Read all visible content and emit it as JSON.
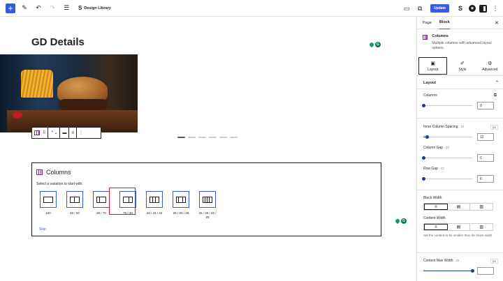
{
  "toolbar": {
    "design_library": "Design Library",
    "update_label": "Update"
  },
  "canvas": {
    "page_title": "GD Details"
  },
  "placeholder": {
    "title": "Columns",
    "instructions": "Select a variation to start with.",
    "variations": [
      {
        "label": "100"
      },
      {
        "label": "50 / 50"
      },
      {
        "label": "30 / 70"
      },
      {
        "label": "70 / 30"
      },
      {
        "label": "33 / 33 / 33"
      },
      {
        "label": "25 / 50 / 25"
      },
      {
        "label": "25 / 25 / 25 / 25"
      }
    ],
    "selected_variation": "70 / 30",
    "skip_label": "Skip"
  },
  "sidebar": {
    "tabs": {
      "page": "Page",
      "block": "Block"
    },
    "block_name": "Columns",
    "block_description": "Multiple columns with advanced layout options.",
    "subtabs": {
      "layout": "Layout",
      "style": "Style",
      "advanced": "Advanced"
    },
    "section_title": "Layout",
    "columns": {
      "label": "Columns",
      "value": "0"
    },
    "inner_column_spacing": {
      "label": "Inner Column Spacing",
      "unit": "px",
      "value": "12"
    },
    "column_gap": {
      "label": "Column Gap",
      "value": "0"
    },
    "row_gap": {
      "label": "Row Gap",
      "value": "0"
    },
    "block_width": {
      "label": "Block Width"
    },
    "content_width": {
      "label": "Content Width",
      "help": "Set the content to be smaller than the block width"
    },
    "content_max_width": {
      "label": "Content Max Width",
      "unit": "px",
      "value": ""
    }
  },
  "colors": {
    "accent": "#3858e9",
    "highlight": "#d11a2a",
    "block_icon": "#7b2d8e"
  }
}
